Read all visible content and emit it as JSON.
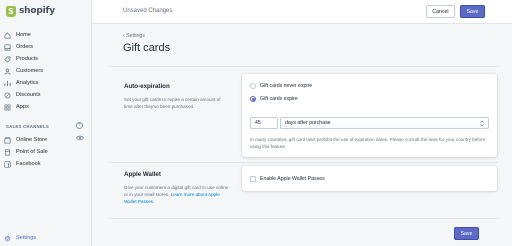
{
  "brand": {
    "name": "shopify",
    "accent": "#5c6ac4",
    "logo_green": "#95bf47"
  },
  "sidebar": {
    "items": [
      {
        "label": "Home",
        "icon": "home-icon"
      },
      {
        "label": "Orders",
        "icon": "orders-icon"
      },
      {
        "label": "Products",
        "icon": "products-icon"
      },
      {
        "label": "Customers",
        "icon": "customers-icon"
      },
      {
        "label": "Analytics",
        "icon": "analytics-icon"
      },
      {
        "label": "Discounts",
        "icon": "discounts-icon"
      },
      {
        "label": "Apps",
        "icon": "apps-icon"
      }
    ],
    "section_label": "SALES CHANNELS",
    "channels": [
      {
        "label": "Online Store",
        "icon": "online-store-icon"
      },
      {
        "label": "Point of Sale",
        "icon": "point-of-sale-icon"
      },
      {
        "label": "Facebook",
        "icon": "facebook-icon"
      }
    ],
    "settings_label": "Settings"
  },
  "topbar": {
    "status": "Unsaved Changes",
    "cancel_label": "Cancel",
    "save_label": "Save"
  },
  "page": {
    "breadcrumb": "Settings",
    "title": "Gift cards"
  },
  "auto_expiration": {
    "title": "Auto-expiration",
    "description": "Set your gift cards to expire a certain amount of time after they've been purchased.",
    "option_never": "Gift cards never expire",
    "option_expire": "Gift cards expire",
    "selected": "option_expire",
    "amount_value": "45",
    "unit_value": "days after purchase",
    "help_text": "In many countries, gift card laws prohibit the use of expiration dates. Please consult the laws for your country before using this feature."
  },
  "apple_wallet": {
    "title": "Apple Wallet",
    "description": "Give your customers a digital gift card to use online or in your retail stores.",
    "link_text": "Learn more about Apple Wallet Passes.",
    "checkbox_label": "Enable Apple Wallet Passes",
    "checked": false
  },
  "footer": {
    "save_label": "Save"
  }
}
